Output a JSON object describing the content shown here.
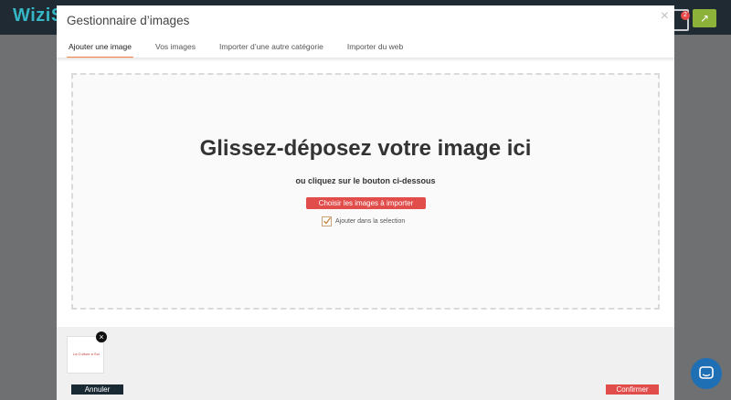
{
  "app": {
    "logo_text": "WiziS",
    "cart_count": "2",
    "icons": [
      "cart-icon",
      "external-link-icon",
      "chat-icon"
    ],
    "colors": {
      "header": "#1f2a33",
      "logo": "#35b6c4",
      "share": "#8db23a",
      "chat": "#1f6fb5"
    }
  },
  "modal": {
    "title": "Gestionnaire d’images",
    "close_icon": "×",
    "tabs": [
      {
        "label": "Ajouter une image",
        "active": true
      },
      {
        "label": "Vos images",
        "active": false
      },
      {
        "label": "Importer d’une autre catégorie",
        "active": false
      },
      {
        "label": "Importer du web",
        "active": false
      }
    ],
    "dropzone": {
      "title": "Glissez-déposez votre image ici",
      "subtitle": "ou cliquez sur le bouton ci-dessous",
      "choose_button": "Choisir les images à importer",
      "add_to_selection_label": "Ajouter dans la selection",
      "add_to_selection_checked": true
    },
    "footer": {
      "thumbnail_text": "La Culture à Soi",
      "remove_icon": "×",
      "cancel_button": "Annuler",
      "confirm_button": "Confirmer"
    },
    "colors": {
      "accent": "#e14d4b",
      "tab_underline": "#f3884a",
      "cancel": "#1a2a35"
    }
  }
}
